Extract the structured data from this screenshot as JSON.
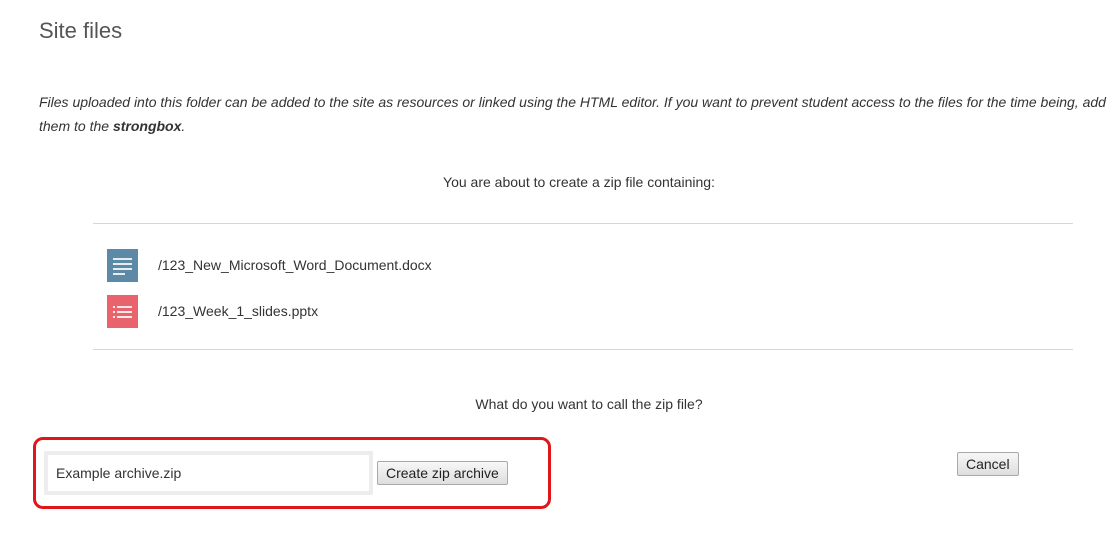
{
  "page": {
    "title": "Site files"
  },
  "intro": {
    "text_before": "Files uploaded into this folder can be added to the site as resources or linked using the HTML editor. If you want to prevent student access to the files for the time being, add them to the ",
    "bold": "strongbox",
    "text_after": "."
  },
  "zip": {
    "about_text": "You are about to create a zip file containing:",
    "files": [
      {
        "name": "/123_New_Microsoft_Word_Document.docx",
        "icon": "word-document-icon",
        "color": "#5b89a6"
      },
      {
        "name": "/123_Week_1_slides.pptx",
        "icon": "powerpoint-icon",
        "color": "#e8636b"
      }
    ],
    "question": "What do you want to call the zip file?",
    "input_value": "Example archive.zip",
    "create_label": "Create zip archive",
    "cancel_label": "Cancel"
  },
  "colors": {
    "highlight": "#e0161b",
    "divider": "#d6d6d6"
  }
}
